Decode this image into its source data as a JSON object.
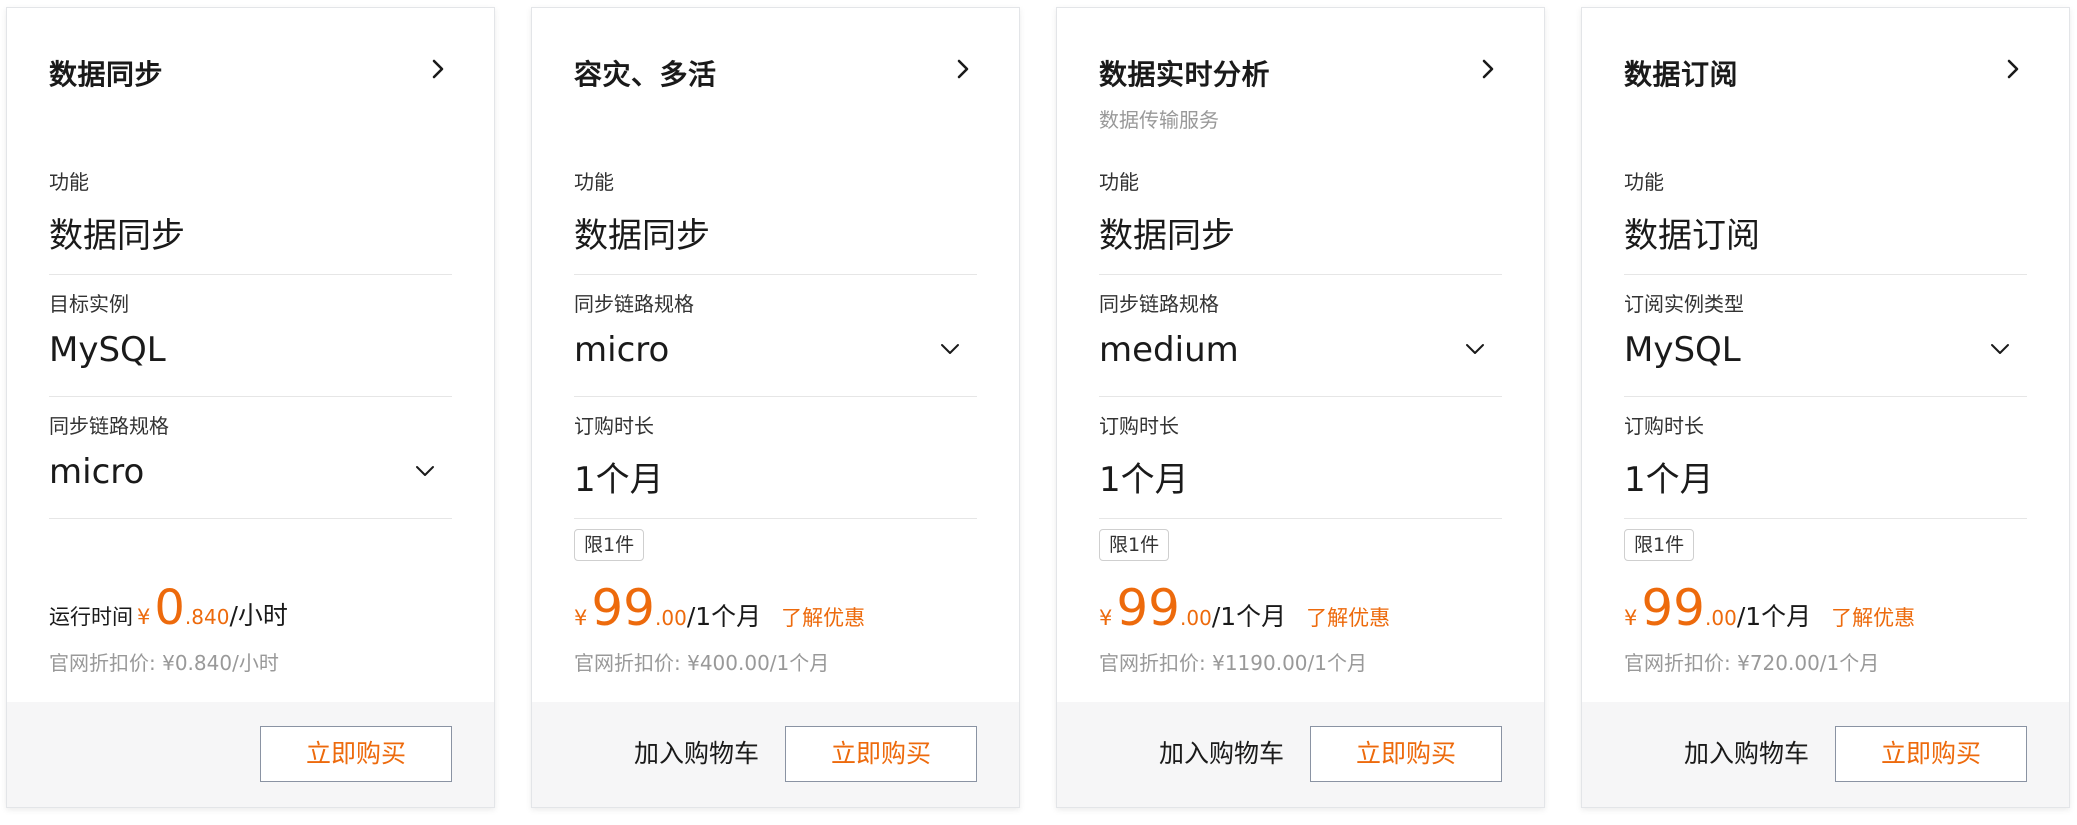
{
  "colors": {
    "accent": "#ed6a0c",
    "muted": "#999999",
    "footer_bg": "#f6f6f7",
    "border": "#e3e5e8"
  },
  "cards": [
    {
      "title": "数据同步",
      "chevron_icon": "chevron-right-icon",
      "fields": [
        {
          "label": "功能",
          "value": "数据同步"
        },
        {
          "label": "目标实例",
          "value": "MySQL"
        },
        {
          "label": "同步链路规格",
          "value": "micro",
          "select_icon": "chevron-down-icon"
        }
      ],
      "price": {
        "prefix": "运行时间",
        "currency": "¥",
        "integer": "0",
        "decimal": ".840",
        "unit": "/小时"
      },
      "original_price": "官网折扣价: ¥0.840/小时",
      "buy_label": "立即购买"
    },
    {
      "title": "容灾、多活",
      "chevron_icon": "chevron-right-icon",
      "fields": [
        {
          "label": "功能",
          "value": "数据同步"
        },
        {
          "label": "同步链路规格",
          "value": "micro",
          "select_icon": "chevron-down-icon"
        },
        {
          "label": "订购时长",
          "value": "1个月"
        }
      ],
      "limit_badge": "限1件",
      "price": {
        "currency": "¥",
        "integer": "99",
        "decimal": ".00",
        "unit": "/1个月",
        "promo_link": "了解优惠"
      },
      "original_price": "官网折扣价: ¥400.00/1个月",
      "cart_label": "加入购物车",
      "buy_label": "立即购买"
    },
    {
      "title": "数据实时分析",
      "subtitle": "数据传输服务",
      "chevron_icon": "chevron-right-icon",
      "fields": [
        {
          "label": "功能",
          "value": "数据同步"
        },
        {
          "label": "同步链路规格",
          "value": "medium",
          "select_icon": "chevron-down-icon"
        },
        {
          "label": "订购时长",
          "value": "1个月"
        }
      ],
      "limit_badge": "限1件",
      "price": {
        "currency": "¥",
        "integer": "99",
        "decimal": ".00",
        "unit": "/1个月",
        "promo_link": "了解优惠"
      },
      "original_price": "官网折扣价: ¥1190.00/1个月",
      "cart_label": "加入购物车",
      "buy_label": "立即购买"
    },
    {
      "title": "数据订阅",
      "chevron_icon": "chevron-right-icon",
      "fields": [
        {
          "label": "功能",
          "value": "数据订阅"
        },
        {
          "label": "订阅实例类型",
          "value": "MySQL",
          "select_icon": "chevron-down-icon"
        },
        {
          "label": "订购时长",
          "value": "1个月"
        }
      ],
      "limit_badge": "限1件",
      "price": {
        "currency": "¥",
        "integer": "99",
        "decimal": ".00",
        "unit": "/1个月",
        "promo_link": "了解优惠"
      },
      "original_price": "官网折扣价: ¥720.00/1个月",
      "cart_label": "加入购物车",
      "buy_label": "立即购买"
    }
  ]
}
